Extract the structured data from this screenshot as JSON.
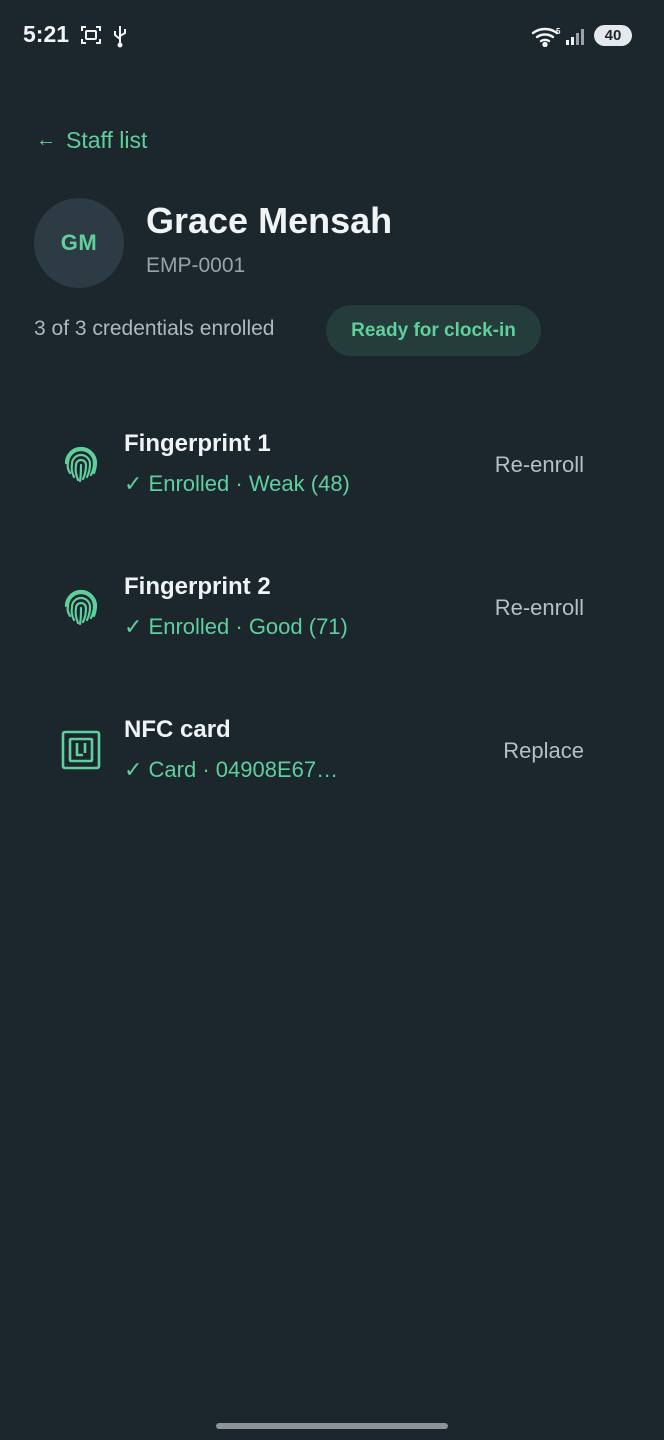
{
  "status_bar": {
    "time": "5:21",
    "battery": "40",
    "icons": [
      "screenshot-icon",
      "usb-icon",
      "wifi-icon",
      "signal-icon",
      "battery-icon"
    ]
  },
  "nav": {
    "back_arrow": "←",
    "back_label": "Staff list"
  },
  "employee": {
    "initials": "GM",
    "name": "Grace Mensah",
    "id": "EMP-0001"
  },
  "summary": {
    "credentials_text": "3 of 3 credentials enrolled",
    "badge": "Ready for clock-in"
  },
  "credentials": [
    {
      "icon": "fingerprint-icon",
      "title": "Fingerprint 1",
      "status": "✓ Enrolled · Weak (48)",
      "action": "Re-enroll"
    },
    {
      "icon": "fingerprint-icon",
      "title": "Fingerprint 2",
      "status": "✓ Enrolled · Good (71)",
      "action": "Re-enroll"
    },
    {
      "icon": "nfc-icon",
      "title": "NFC card",
      "status": "✓ Card · 04908E67…",
      "action": "Replace"
    }
  ],
  "colors": {
    "background": "#1b262d",
    "accent": "#5fcf9c",
    "badge_bg": "#243c3a",
    "avatar_bg": "#2c3b44"
  }
}
